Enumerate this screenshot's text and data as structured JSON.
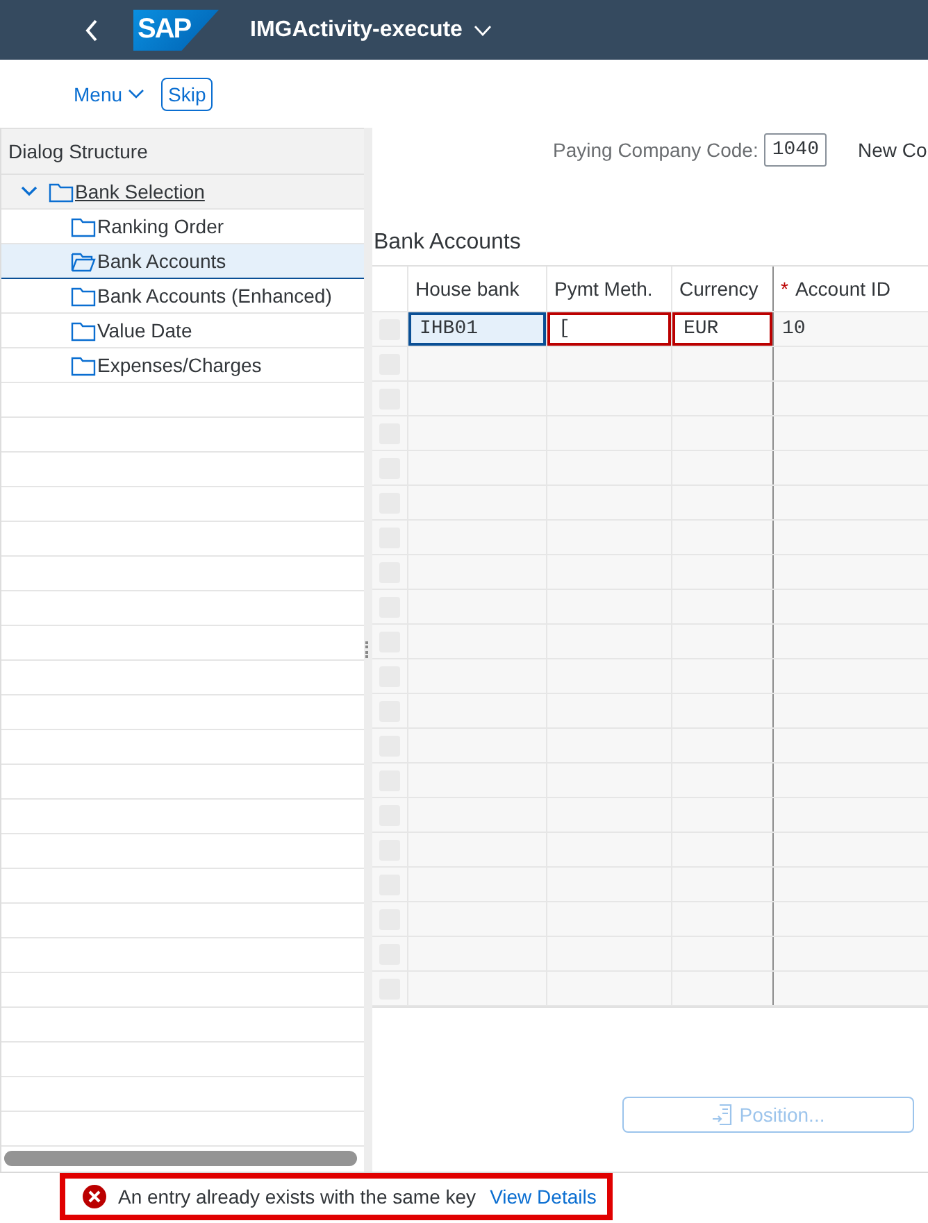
{
  "shell_bar": {
    "logo": "SAP",
    "title": "IMGActivity-execute"
  },
  "toolbar": {
    "menu": "Menu",
    "skip": "Skip"
  },
  "dialog_structure": {
    "title": "Dialog Structure",
    "items": [
      {
        "label": "Bank Selection",
        "expanded": true,
        "selected": false,
        "children": [
          {
            "label": "Ranking Order",
            "selected": false
          },
          {
            "label": "Bank Accounts",
            "selected": true
          },
          {
            "label": "Bank Accounts (Enhanced)",
            "selected": false
          },
          {
            "label": "Value Date",
            "selected": false
          },
          {
            "label": "Expenses/Charges",
            "selected": false
          }
        ]
      }
    ]
  },
  "header_fields": [
    {
      "label": "Paying Company Code:",
      "value": "1040"
    },
    {
      "label": "New Co"
    }
  ],
  "table": {
    "title": "Bank Accounts",
    "columns": [
      {
        "label": "House bank"
      },
      {
        "label": "Pymt Meth."
      },
      {
        "label": "Currency"
      },
      {
        "label": "Account ID",
        "required_mark": "*"
      }
    ],
    "rows": [
      {
        "cells": [
          {
            "value": "IHB01",
            "focused": true,
            "invalid": false
          },
          {
            "value": "[",
            "focused": false,
            "invalid": true
          },
          {
            "value": "EUR",
            "focused": false,
            "invalid": true
          },
          {
            "value": "10",
            "focused": false,
            "invalid": false
          }
        ]
      }
    ]
  },
  "position_button": {
    "label": "Position...",
    "disabled": true
  },
  "message": {
    "text": "An entry already exists with the same key",
    "link": "View Details",
    "error": true
  }
}
